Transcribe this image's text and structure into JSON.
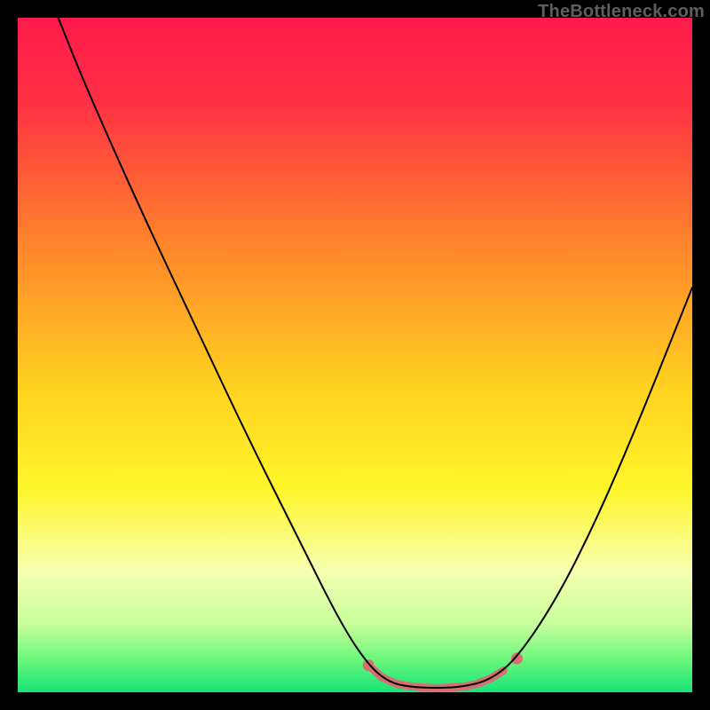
{
  "watermark": "TheBottleneck.com",
  "chart_data": {
    "type": "line",
    "title": "",
    "xlabel": "",
    "ylabel": "",
    "xlim": [
      0,
      100
    ],
    "ylim": [
      0,
      100
    ],
    "gradient_stops": [
      {
        "offset": 0.0,
        "color": "#ff1a4b"
      },
      {
        "offset": 0.12,
        "color": "#ff2f44"
      },
      {
        "offset": 0.35,
        "color": "#ff8a2a"
      },
      {
        "offset": 0.55,
        "color": "#ffd21f"
      },
      {
        "offset": 0.7,
        "color": "#fff62a"
      },
      {
        "offset": 0.82,
        "color": "#f6ffb0"
      },
      {
        "offset": 0.9,
        "color": "#c7ff9a"
      },
      {
        "offset": 0.95,
        "color": "#6cf77c"
      },
      {
        "offset": 1.0,
        "color": "#17e478"
      }
    ],
    "series": [
      {
        "name": "curve",
        "stroke": "#000000",
        "stroke_width": 2,
        "points": [
          {
            "x": 6.0,
            "y": 100.0
          },
          {
            "x": 10.0,
            "y": 90.0
          },
          {
            "x": 18.0,
            "y": 72.0
          },
          {
            "x": 26.0,
            "y": 55.0
          },
          {
            "x": 34.0,
            "y": 38.0
          },
          {
            "x": 42.0,
            "y": 22.0
          },
          {
            "x": 48.0,
            "y": 10.0
          },
          {
            "x": 52.0,
            "y": 4.0
          },
          {
            "x": 55.0,
            "y": 1.5
          },
          {
            "x": 58.0,
            "y": 0.8
          },
          {
            "x": 62.0,
            "y": 0.6
          },
          {
            "x": 66.0,
            "y": 0.8
          },
          {
            "x": 70.0,
            "y": 1.8
          },
          {
            "x": 74.0,
            "y": 5.0
          },
          {
            "x": 80.0,
            "y": 14.0
          },
          {
            "x": 86.0,
            "y": 26.0
          },
          {
            "x": 92.0,
            "y": 40.0
          },
          {
            "x": 98.0,
            "y": 55.0
          },
          {
            "x": 100.0,
            "y": 60.0
          }
        ]
      }
    ],
    "highlight": {
      "color": "#d66f6f",
      "stroke_width": 9,
      "dot_radius": 6.5,
      "points": [
        {
          "x": 52.0,
          "y": 4.0
        },
        {
          "x": 54.0,
          "y": 2.2
        },
        {
          "x": 56.0,
          "y": 1.3
        },
        {
          "x": 58.0,
          "y": 0.9
        },
        {
          "x": 60.0,
          "y": 0.7
        },
        {
          "x": 62.0,
          "y": 0.6
        },
        {
          "x": 64.0,
          "y": 0.7
        },
        {
          "x": 66.0,
          "y": 0.8
        },
        {
          "x": 68.0,
          "y": 1.2
        },
        {
          "x": 70.0,
          "y": 2.0
        },
        {
          "x": 72.0,
          "y": 3.2
        }
      ],
      "end_dot": {
        "x": 74.0,
        "y": 5.0
      }
    }
  }
}
